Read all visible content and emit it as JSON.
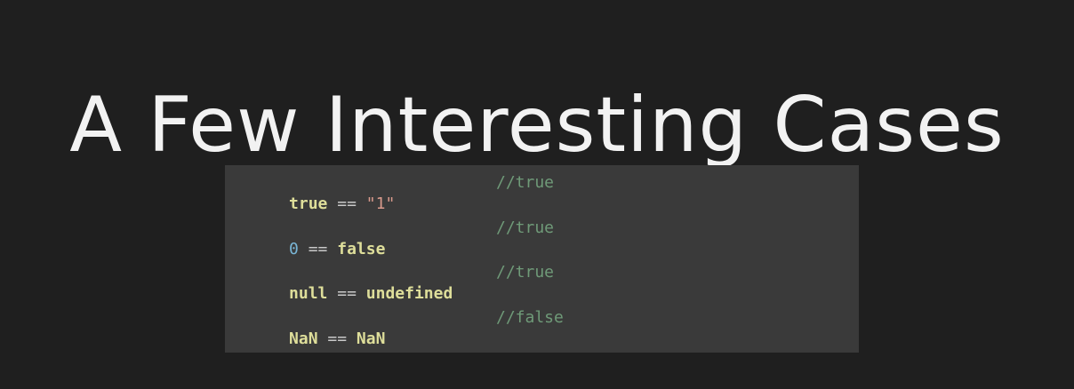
{
  "slide": {
    "title": "A Few Interesting Cases"
  },
  "code": {
    "lines": [
      {
        "left": "true",
        "op": "==",
        "right": "\"1\"",
        "comment": "//true"
      },
      {
        "left": "0",
        "op": "==",
        "right": "false",
        "comment": "//true"
      },
      {
        "left": "null",
        "op": "==",
        "right": "undefined",
        "comment": "//true"
      },
      {
        "left": "NaN",
        "op": "==",
        "right": "NaN",
        "comment": "//false"
      }
    ]
  },
  "colors": {
    "background": "#1f1f1f",
    "code_background": "#3a3a3a",
    "keyword": "#dede9a",
    "operator": "#c9c9c9",
    "string": "#d99a8c",
    "number": "#79b6d6",
    "comment": "#6f9a78"
  }
}
